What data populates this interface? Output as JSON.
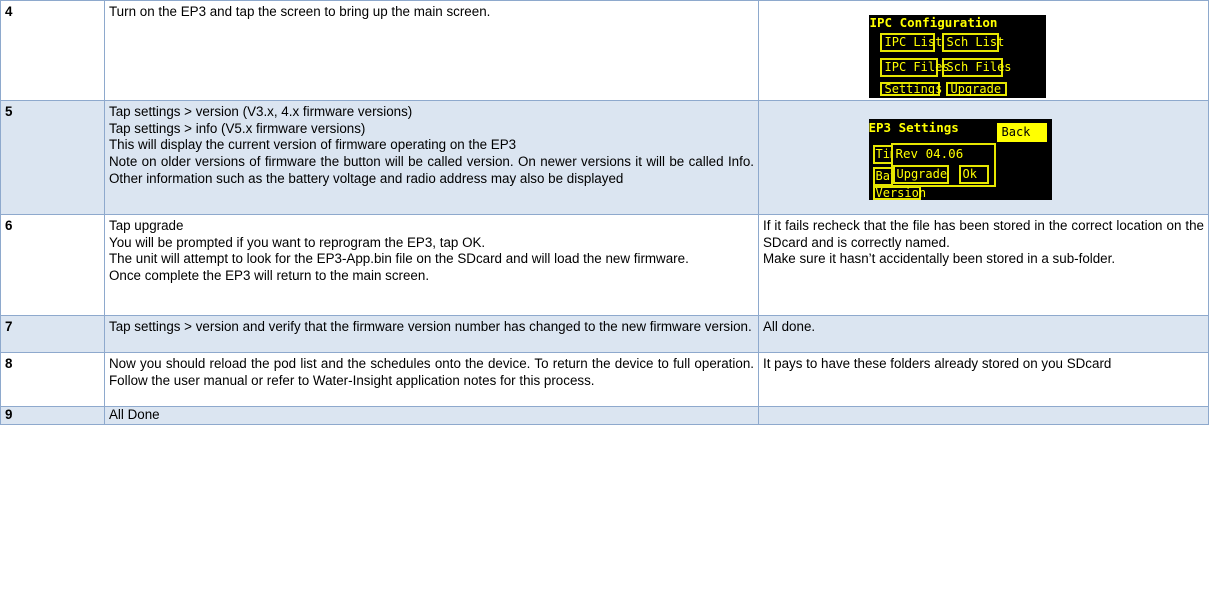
{
  "rows": [
    {
      "number": "4",
      "lines": [
        "Turn on the EP3 and tap the screen to bring up the main screen."
      ],
      "note_lines": []
    },
    {
      "number": "5",
      "lines": [
        "Tap settings > version (V3.x, 4.x firmware versions)",
        "Tap settings > info (V5.x firmware versions)",
        "This will display the current version of firmware operating on the EP3"
      ],
      "paragraph": "Note on older versions of firmware the button will be called version. On newer versions it will be called Info. Other information such as the battery voltage and radio address may also be displayed",
      "note_lines": []
    },
    {
      "number": "6",
      "lines": [
        "Tap upgrade",
        "You will be prompted if you want to reprogram the EP3, tap OK."
      ],
      "paragraph": "The unit will attempt to look for the EP3-App.bin file on the SDcard and will load the new firmware.",
      "lines_after": [
        "Once complete the EP3 will return to the main screen."
      ],
      "note_paragraph": "If it fails recheck that the file has been stored in the correct location on the SDcard and is correctly named.",
      "note_paragraph2": "Make sure it hasn’t accidentally been stored in a sub-folder."
    },
    {
      "number": "7",
      "paragraph": "Tap settings > version and verify that the firmware version number has changed to the new firmware version.",
      "note": "All done."
    },
    {
      "number": "8",
      "paragraph": "Now you should reload the pod list and the schedules onto the device. To return the device to full operation. Follow the user manual or refer to Water-Insight application notes for this process.",
      "note_paragraph": "It pays to have these folders already stored on you SDcard"
    },
    {
      "number": "9",
      "lines": [
        "All Done"
      ]
    }
  ],
  "screen_main": {
    "title": "IPC Configuration",
    "buttons": [
      "IPC List",
      "Sch List",
      "IPC Files",
      "Sch Files",
      "Settings",
      "Upgrade"
    ]
  },
  "screen_settings": {
    "title": "EP3 Settings",
    "back": "Back",
    "side_buttons": [
      "Tim",
      "Bat",
      "Version"
    ],
    "popup_text": "Rev 04.06",
    "popup_upgrade": "Upgrade",
    "popup_ok": "Ok"
  },
  "colors": {
    "shade": "#dbe5f1",
    "border": "#8ea9cd",
    "screen_text": "#ffff00",
    "screen_bg": "#000000"
  }
}
